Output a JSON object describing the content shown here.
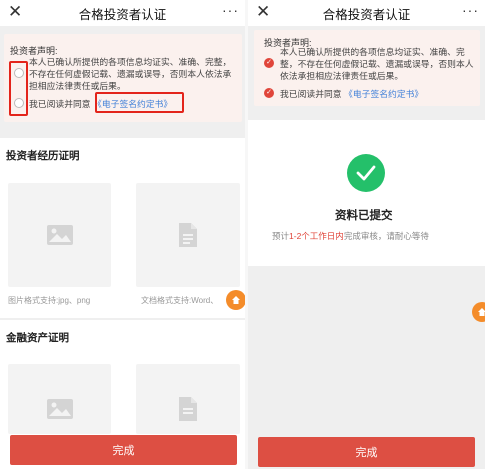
{
  "left": {
    "nav": {
      "close": "✕",
      "title": "合格投资者认证",
      "more": "···"
    },
    "declaration": {
      "title": "投资者声明:",
      "body": "本人已确认所提供的各项信息均证实、准确、完整，不存在任何虚假记载、遗漏或误导，否则本人依法承担相应法律责任或后果。",
      "agree_prefix": "我已阅读并同意",
      "agree_link": "《电子签名约定书》"
    },
    "section1": {
      "title": "投资者经历证明",
      "card1_caption": "图片格式支持:jpg、png",
      "card2_caption": "文档格式支持:Word、"
    },
    "section2": {
      "title": "金融资产证明"
    },
    "button": "完成"
  },
  "right": {
    "nav": {
      "close": "✕",
      "title": "合格投资者认证",
      "more": "···"
    },
    "declaration": {
      "title": "投资者声明:",
      "body": "本人已确认所提供的各项信息均证实、准确、完整，不存在任何虚假记载、遗漏或误导，否则本人依法承担相应法律责任或后果。",
      "agree_prefix": "我已阅读并同意",
      "agree_link": "《电子签名约定书》"
    },
    "success": {
      "title": "资料已提交",
      "desc_prefix": "预计",
      "desc_highlight": "1-2个工作日内",
      "desc_suffix": "完成审核，请耐心等待"
    },
    "button": "完成"
  },
  "colors": {
    "accent": "#dd4f43",
    "link": "#3f7fd8",
    "success": "#24c06a",
    "float": "#f48c2a",
    "annotation": "#e3241b"
  },
  "icons": [
    "close-icon",
    "more-icon",
    "radio-icon",
    "check-icon",
    "image-icon",
    "document-icon",
    "home-icon",
    "success-check-icon"
  ]
}
